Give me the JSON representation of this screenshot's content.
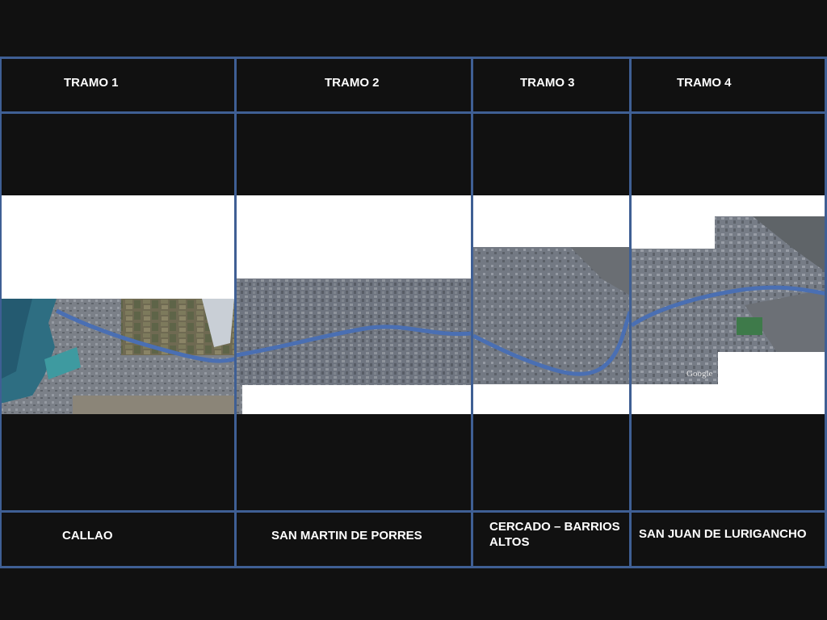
{
  "colors": {
    "background": "#111111",
    "grid": "#3f5f94",
    "river": "#4a6fb3",
    "text": "#ffffff"
  },
  "header": {
    "tramos": [
      "TRAMO 1",
      "TRAMO 2",
      "TRAMO 3",
      "TRAMO 4"
    ]
  },
  "footer": {
    "districts": [
      "CALLAO",
      "SAN MARTIN DE PORRES",
      "CERCADO – BARRIOS ALTOS",
      "SAN JUAN DE LURIGANCHO"
    ]
  },
  "map": {
    "watermark": "Google"
  }
}
